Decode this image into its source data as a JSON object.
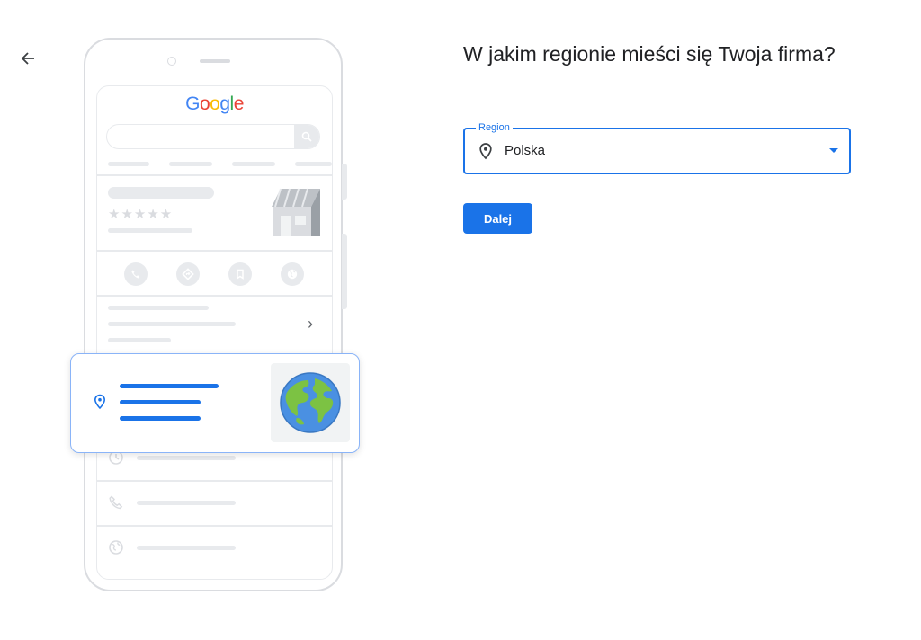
{
  "navigation": {
    "back_icon": "arrow-left-icon"
  },
  "illustration": {
    "logo_text": "Google",
    "logo_colors": [
      "#4285F4",
      "#EA4335",
      "#FBBC05",
      "#4285F4",
      "#34A853",
      "#EA4335"
    ],
    "stars": "★★★★★",
    "action_icons": [
      "phone-icon",
      "directions-icon",
      "bookmark-icon",
      "website-icon"
    ],
    "chevron": "›",
    "card_pin_icon": "location-pin-icon",
    "card_globe_icon": "globe-icon",
    "list_icons": [
      "clock-icon",
      "phone-icon",
      "website-icon"
    ]
  },
  "form": {
    "title": "W jakim regionie mieści się Twoja firma?",
    "region_label": "Region",
    "region_value": "Polska",
    "region_icon": "location-pin-icon",
    "dropdown_icon": "dropdown-arrow-icon",
    "next_button": "Dalej",
    "accent_color": "#1a73e8"
  }
}
